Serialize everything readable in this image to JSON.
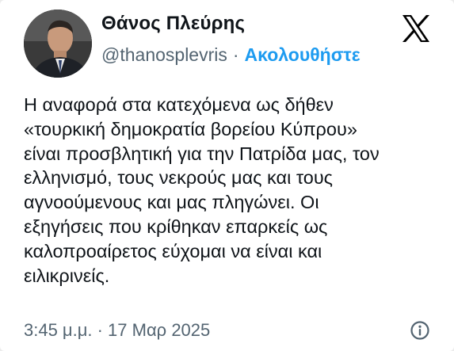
{
  "author": {
    "display_name": "Θάνος Πλεύρης",
    "handle": "@thanosplevris",
    "separator": "·",
    "follow_label": "Ακολουθήστε",
    "avatar_icon": "profile-photo",
    "platform_icon": "x-logo-icon"
  },
  "tweet": {
    "lines": [
      "Η αναφορά στα κατεχόμενα ως δήθεν",
      "«τουρκική δημοκρατία βορείου Κύπρου»",
      "είναι προσβλητική για την Πατρίδα μας, τον",
      "ελληνισμό, τους νεκρούς μας και τους",
      "αγνοούμενους και μας πληγώνει. Οι",
      "εξηγήσεις που κρίθηκαν επαρκείς ως",
      "καλοπροαίρετος εύχομαι να είναι και",
      "ειλικρινείς."
    ],
    "timestamp": "3:45 μ.μ. · 17 Μαρ 2025",
    "info_icon": "info-icon"
  },
  "colors": {
    "accent": "#1d9bf0",
    "secondary_text": "#536471",
    "primary_text": "#0f1419",
    "background": "#ffffff"
  }
}
